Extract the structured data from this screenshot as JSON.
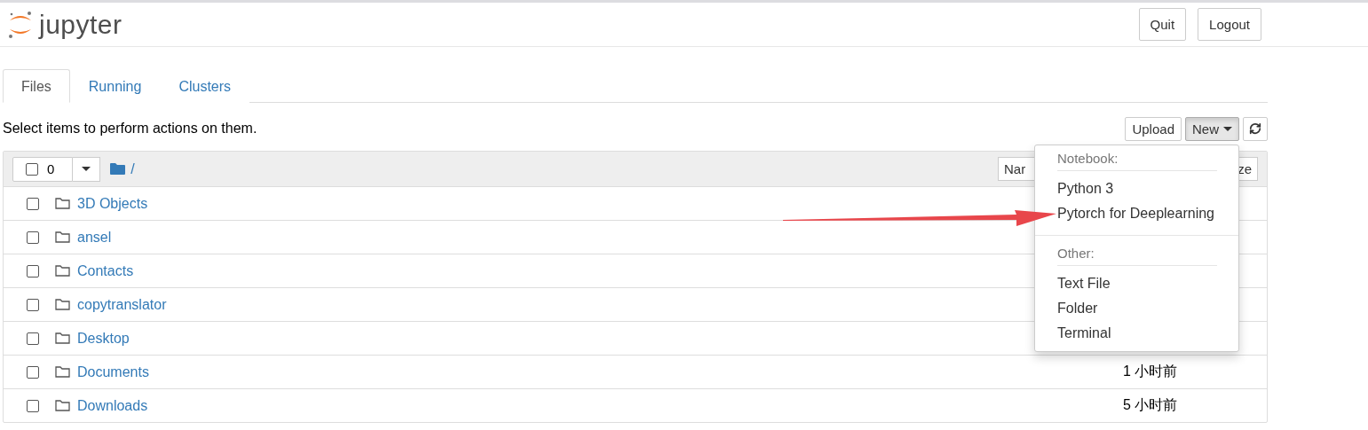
{
  "header": {
    "logo": "jupyter",
    "buttons": [
      "Quit",
      "Logout"
    ]
  },
  "tabs": [
    {
      "label": "Files",
      "selected": true
    },
    {
      "label": "Running",
      "selected": false
    },
    {
      "label": "Clusters",
      "selected": false
    }
  ],
  "hint": "Select items to perform actions on them.",
  "toolbar": [
    {
      "kind": "text",
      "label": "Upload",
      "selected": false
    },
    {
      "kind": "dropdown",
      "label": "New",
      "selected": true
    },
    {
      "kind": "refresh",
      "selected": false
    }
  ],
  "list_header": {
    "count": "0",
    "checked": false,
    "path": "/",
    "sort_buttons": [
      "Nar",
      "ze"
    ]
  },
  "rows": [
    {
      "name": "3D Objects",
      "checked": false
    },
    {
      "name": "ansel",
      "checked": false
    },
    {
      "name": "Contacts",
      "checked": false
    },
    {
      "name": "copytranslator",
      "checked": false
    },
    {
      "name": "Desktop",
      "checked": false
    },
    {
      "name": "Documents",
      "checked": false,
      "modified": "1 小时前"
    },
    {
      "name": "Downloads",
      "checked": false,
      "modified": "5 小时前"
    }
  ],
  "menu": {
    "sections": [
      {
        "heading": "Notebook:",
        "items": [
          "Python 3",
          "Pytorch for Deeplearning"
        ]
      },
      {
        "heading": "Other:",
        "items": [
          "Text File",
          "Folder",
          "Terminal"
        ]
      }
    ]
  }
}
